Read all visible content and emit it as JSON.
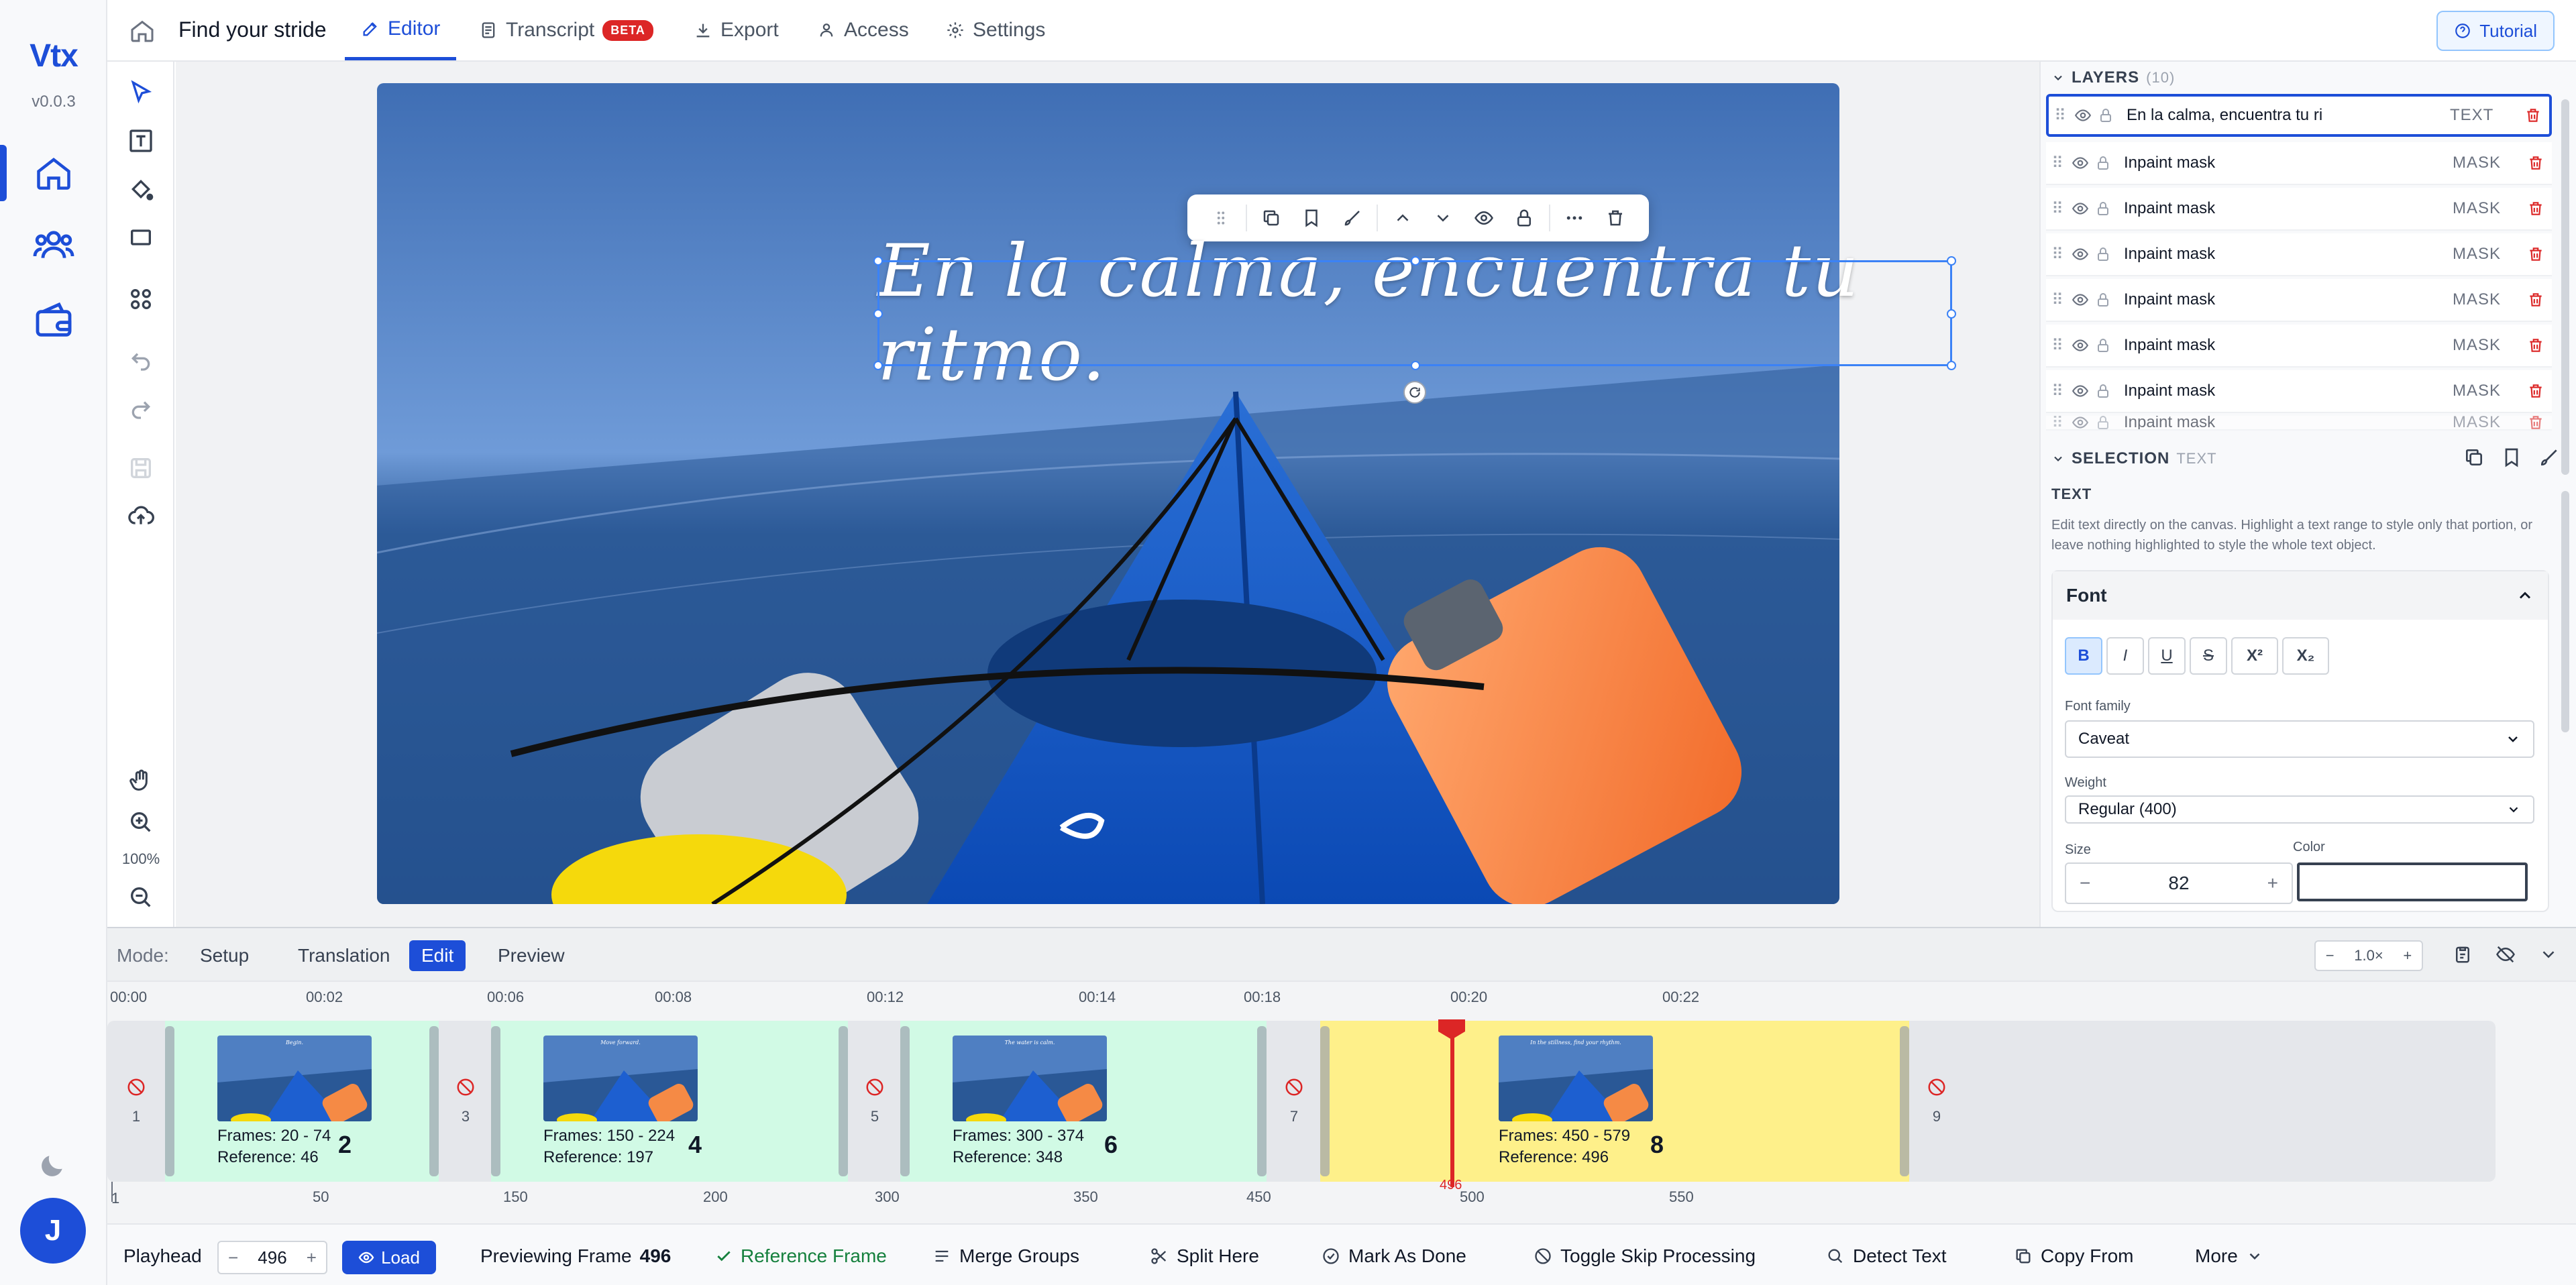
{
  "app": {
    "logo": "Vtx",
    "version": "v0.0.3",
    "user_initial": "J"
  },
  "project": {
    "title": "Find your stride"
  },
  "tabs": [
    {
      "label": "Editor",
      "icon": "edit-icon"
    },
    {
      "label": "Transcript",
      "icon": "document-icon",
      "badge": "BETA"
    },
    {
      "label": "Export",
      "icon": "download-icon"
    },
    {
      "label": "Access",
      "icon": "users-icon"
    },
    {
      "label": "Settings",
      "icon": "gear-icon"
    }
  ],
  "tutorial_label": "Tutorial",
  "tools": {
    "zoom": "100%"
  },
  "canvas": {
    "caption": "En la calma, encuentra tu ritmo."
  },
  "layers": {
    "title": "LAYERS",
    "count": "(10)",
    "items": [
      {
        "name": "En la calma, encuentra tu ri",
        "kind": "TEXT"
      },
      {
        "name": "Inpaint mask",
        "kind": "MASK"
      },
      {
        "name": "Inpaint mask",
        "kind": "MASK"
      },
      {
        "name": "Inpaint mask",
        "kind": "MASK"
      },
      {
        "name": "Inpaint mask",
        "kind": "MASK"
      },
      {
        "name": "Inpaint mask",
        "kind": "MASK"
      },
      {
        "name": "Inpaint mask",
        "kind": "MASK"
      },
      {
        "name": "Inpaint mask",
        "kind": "MASK"
      }
    ]
  },
  "selection": {
    "title": "SELECTION",
    "type": "TEXT",
    "label": "TEXT",
    "help": "Edit text directly on the canvas. Highlight a text range to style only that portion, or leave nothing highlighted to style the whole text object.",
    "font_section": "Font",
    "format_buttons": [
      "B",
      "I",
      "U",
      "S",
      "X²",
      "X₂"
    ],
    "font_family_label": "Font family",
    "font_family": "Caveat",
    "weight_label": "Weight",
    "weight": "Regular (400)",
    "size_label": "Size",
    "size": "82",
    "color_label": "Color",
    "minus": "−",
    "plus": "+"
  },
  "modes": {
    "label": "Mode:",
    "items": [
      "Setup",
      "Translation",
      "Edit",
      "Preview"
    ],
    "active": "Edit"
  },
  "playback_rate": "1.0×",
  "ruler_times": [
    "00:00",
    "00:02",
    "00:06",
    "00:08",
    "00:12",
    "00:14",
    "00:18",
    "00:20",
    "00:22"
  ],
  "segments": [
    {
      "gap": "1"
    },
    {
      "frames": "Frames: 20 - 74",
      "reference": "Reference: 46",
      "number": "2",
      "thumb_text": "Begin."
    },
    {
      "gap": "3"
    },
    {
      "frames": "Frames: 150 - 224",
      "reference": "Reference: 197",
      "number": "4",
      "thumb_text": "Move forward."
    },
    {
      "gap": "5"
    },
    {
      "frames": "Frames: 300 - 374",
      "reference": "Reference: 348",
      "number": "6",
      "thumb_text": "The water is calm."
    },
    {
      "gap": "7"
    },
    {
      "frames": "Frames: 450 - 579",
      "reference": "Reference: 496",
      "number": "8",
      "thumb_text": "In the stillness, find your rhythm."
    },
    {
      "gap": "9"
    }
  ],
  "frame_ruler": [
    "1",
    "50",
    "150",
    "200",
    "300",
    "350",
    "450",
    "500",
    "550"
  ],
  "playhead_marker": "496",
  "controls": {
    "playhead_label": "Playhead",
    "playhead_value": "496",
    "minus": "−",
    "plus": "+",
    "load": "Load",
    "previewing": "Previewing Frame",
    "previewing_frame": "496",
    "reference_frame": "Reference Frame",
    "merge": "Merge Groups",
    "split": "Split Here",
    "done": "Mark As Done",
    "skip": "Toggle Skip Processing",
    "detect": "Detect Text",
    "copy": "Copy From",
    "more": "More"
  },
  "colors": {
    "accent": "#1d4ed8",
    "danger": "#dc2626",
    "segment_green": "#d1fae5",
    "segment_yellow": "#fef08a"
  }
}
